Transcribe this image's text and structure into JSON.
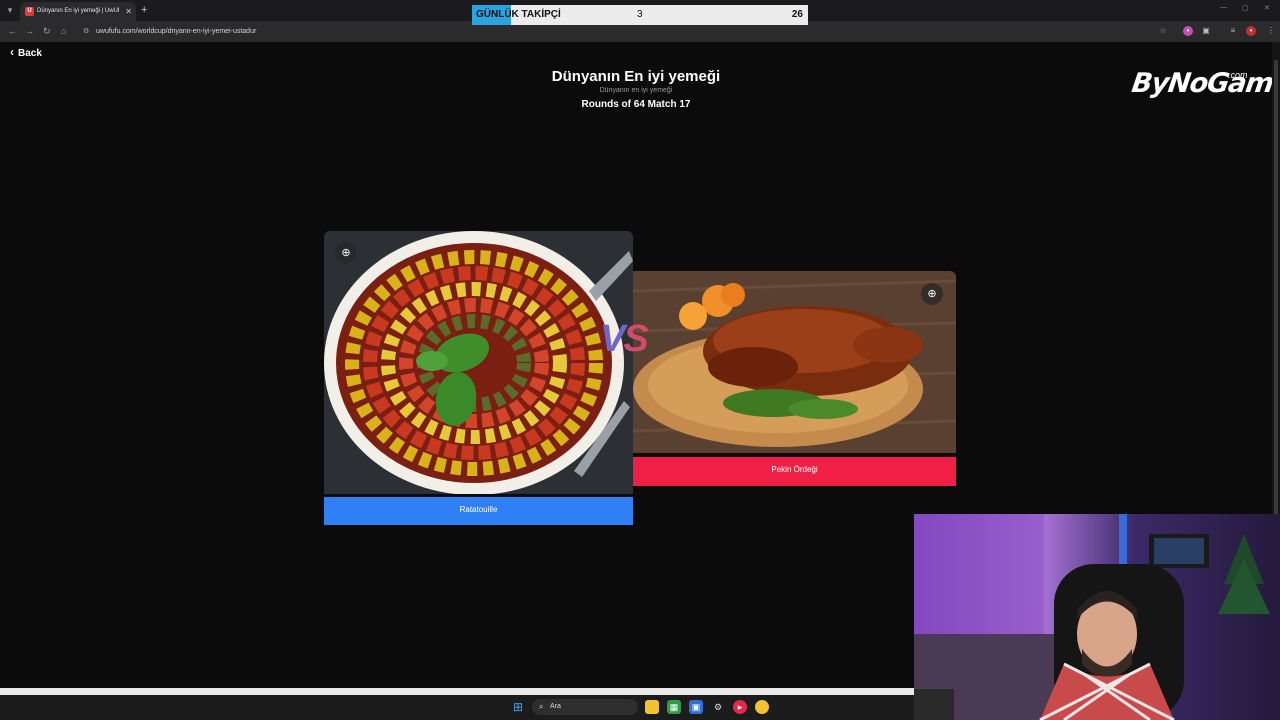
{
  "browser": {
    "tab_title": "Dünyanın En iyi yemeği | UwUFUFU",
    "tab_favicon_letter": "U",
    "url": "uwufufu.com/worldcup/dnyann-en-iyi-yemei-ustadur"
  },
  "overlay": {
    "label": "GÜNLÜK TAKİPÇİ",
    "current": "3",
    "goal": "26"
  },
  "page": {
    "back_label": "Back",
    "title": "Dünyanın En iyi yemeği",
    "subtitle": "Dünyanın en iyi yemeği",
    "round_info": "Rounds of 64 Match 17",
    "logo_text": "ByNoGame",
    "logo_suffix": ".com",
    "vs_v": "V",
    "vs_s": "S"
  },
  "choices": [
    {
      "label": "Ratatouille",
      "button_color": "#2f80f5",
      "zoom_icon": "zoom-in-icon"
    },
    {
      "label": "Pekin Ördeği",
      "button_color": "#ef1f45",
      "zoom_icon": "zoom-in-icon"
    }
  ],
  "taskbar": {
    "search_label": "Ara"
  },
  "colors": {
    "accent_blue": "#2aa4de",
    "page_bg": "#0b0b0b"
  }
}
